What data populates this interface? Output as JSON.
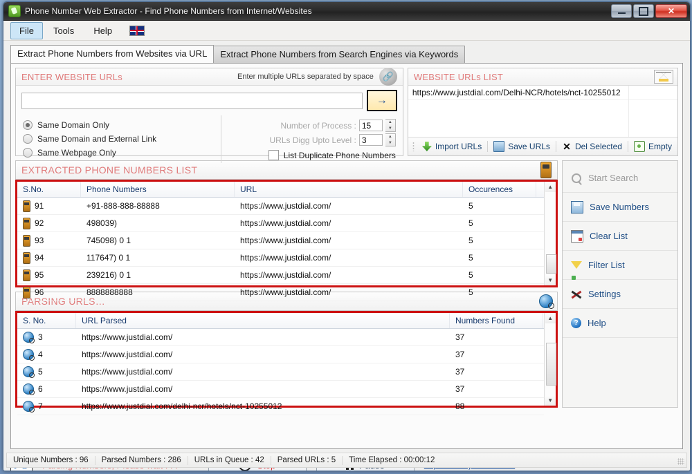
{
  "window": {
    "title": "Phone Number Web Extractor - Find Phone Numbers from Internet/Websites",
    "app_icon": "phone-app-icon",
    "minimize": "–",
    "maximize": "❐",
    "close": "✕"
  },
  "menu": {
    "items": [
      "File",
      "Tools",
      "Help"
    ],
    "flag_icon": "uk-flag-icon"
  },
  "tabs": [
    {
      "label": "Extract Phone Numbers from Websites via URL",
      "selected": true
    },
    {
      "label": "Extract Phone Numbers from Search Engines via Keywords",
      "selected": false
    }
  ],
  "enter_urls": {
    "title": "ENTER WEBSITE URLs",
    "hint": "Enter multiple URLs separated by space",
    "link_icon": "link-chain-icon",
    "input_value": "",
    "input_placeholder": "",
    "go_label": "→",
    "radios": [
      {
        "label": "Same Domain Only",
        "checked": true
      },
      {
        "label": "Same Domain and External Link",
        "checked": false
      },
      {
        "label": "Same Webpage Only",
        "checked": false
      }
    ],
    "spinners": [
      {
        "label": "Number of Process :",
        "value": "15"
      },
      {
        "label": "URLs Digg Upto Level :",
        "value": "3"
      }
    ],
    "checkbox": {
      "label": "List Duplicate Phone Numbers",
      "checked": false
    }
  },
  "urls_list": {
    "title": "WEBSITE URLs LIST",
    "header_icon": "mail-stack-icon",
    "rows": [
      "https://www.justdial.com/Delhi-NCR/hotels/nct-10255012"
    ],
    "buttons": [
      {
        "label": "Import URLs",
        "icon": "import-download-icon"
      },
      {
        "label": "Save URLs",
        "icon": "save-disk-icon"
      },
      {
        "label": "Del Selected",
        "icon": "delete-x-icon"
      },
      {
        "label": "Empty",
        "icon": "empty-bin-icon"
      }
    ]
  },
  "extracted": {
    "title": "EXTRACTED PHONE NUMBERS LIST",
    "header_icon": "mobile-phone-icon",
    "columns": [
      "S.No.",
      "Phone Numbers",
      "URL",
      "Occurences"
    ],
    "rows": [
      {
        "sno": "91",
        "phone": "+91-888-888-88888",
        "url": "https://www.justdial.com/",
        "occ": "5"
      },
      {
        "sno": "92",
        "phone": "498039)",
        "url": "https://www.justdial.com/",
        "occ": "5"
      },
      {
        "sno": "93",
        "phone": "745098) 0 1",
        "url": "https://www.justdial.com/",
        "occ": "5"
      },
      {
        "sno": "94",
        "phone": "117647) 0 1",
        "url": "https://www.justdial.com/",
        "occ": "5"
      },
      {
        "sno": "95",
        "phone": "239216) 0 1",
        "url": "https://www.justdial.com/",
        "occ": "5"
      },
      {
        "sno": "96",
        "phone": "8888888888",
        "url": "https://www.justdial.com/",
        "occ": "5"
      }
    ]
  },
  "parsing": {
    "title": "PARSING URLS…",
    "header_icon": "globe-search-icon",
    "columns": [
      "S. No.",
      "URL Parsed",
      "Numbers Found"
    ],
    "rows": [
      {
        "sno": "3",
        "url": "https://www.justdial.com/",
        "found": "37"
      },
      {
        "sno": "4",
        "url": "https://www.justdial.com/",
        "found": "37"
      },
      {
        "sno": "5",
        "url": "https://www.justdial.com/",
        "found": "37"
      },
      {
        "sno": "6",
        "url": "https://www.justdial.com/",
        "found": "37"
      },
      {
        "sno": "7",
        "url": "https://www.justdial.com/delhi-ncr/hotels/nct-10255012",
        "found": "88"
      }
    ]
  },
  "sidebar": {
    "items": [
      {
        "label": "Start Search",
        "icon": "magnifier-icon",
        "disabled": true
      },
      {
        "label": "Save Numbers",
        "icon": "save-disk-icon",
        "disabled": false
      },
      {
        "label": "Clear List",
        "icon": "clear-list-icon",
        "disabled": false
      },
      {
        "label": "Filter List",
        "icon": "filter-funnel-icon",
        "disabled": false
      },
      {
        "label": "Settings",
        "icon": "tools-icon",
        "disabled": false
      },
      {
        "label": "Help",
        "icon": "help-question-icon",
        "disabled": false
      }
    ]
  },
  "bottom": {
    "progress_icon": "parsing-activity-icon",
    "status_text": "Parsing Numbers, Please wait . . .",
    "stop_label": "Stop",
    "pause_label": "Pause",
    "current_url": "https://www.justdial.com/"
  },
  "statusbar": [
    "Unique Numbers :  96",
    "Parsed Numbers :  286",
    "URLs in Queue :  42",
    "Parsed URLs :  5",
    "Time Elapsed :   00:00:12"
  ],
  "colors": {
    "accent_red": "#cc1111",
    "title_pink": "#e07a7a",
    "link_blue": "#1a4f9c"
  }
}
